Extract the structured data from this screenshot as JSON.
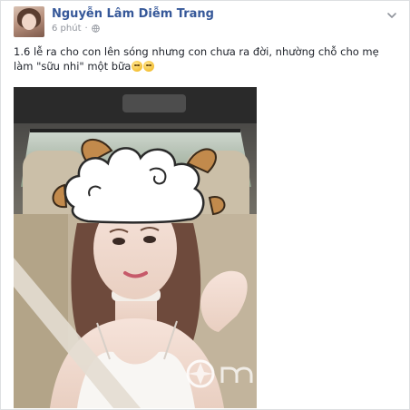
{
  "post": {
    "author": {
      "name": "Nguyễn Lâm Diễm Trang",
      "avatar_icon": "profile-photo"
    },
    "timestamp": "6 phút",
    "privacy_icon": "globe-icon",
    "menu_icon": "chevron-down-icon",
    "caption": "1.6 lễ ra cho con lên sóng nhưng con chưa ra đời, nhường chỗ cho mẹ làm \"sữu nhi\" một bữa",
    "caption_emojis": [
      "relieved-face-emoji",
      "grinning-face-emoji"
    ],
    "photo": {
      "description_icon": "selfie-photo",
      "watermark_icon": "ngoisao-watermark-logo"
    }
  },
  "colors": {
    "author_link": "#365899",
    "meta_text": "#90949c",
    "body_text": "#1d2129",
    "card_border": "#dddfe2"
  }
}
